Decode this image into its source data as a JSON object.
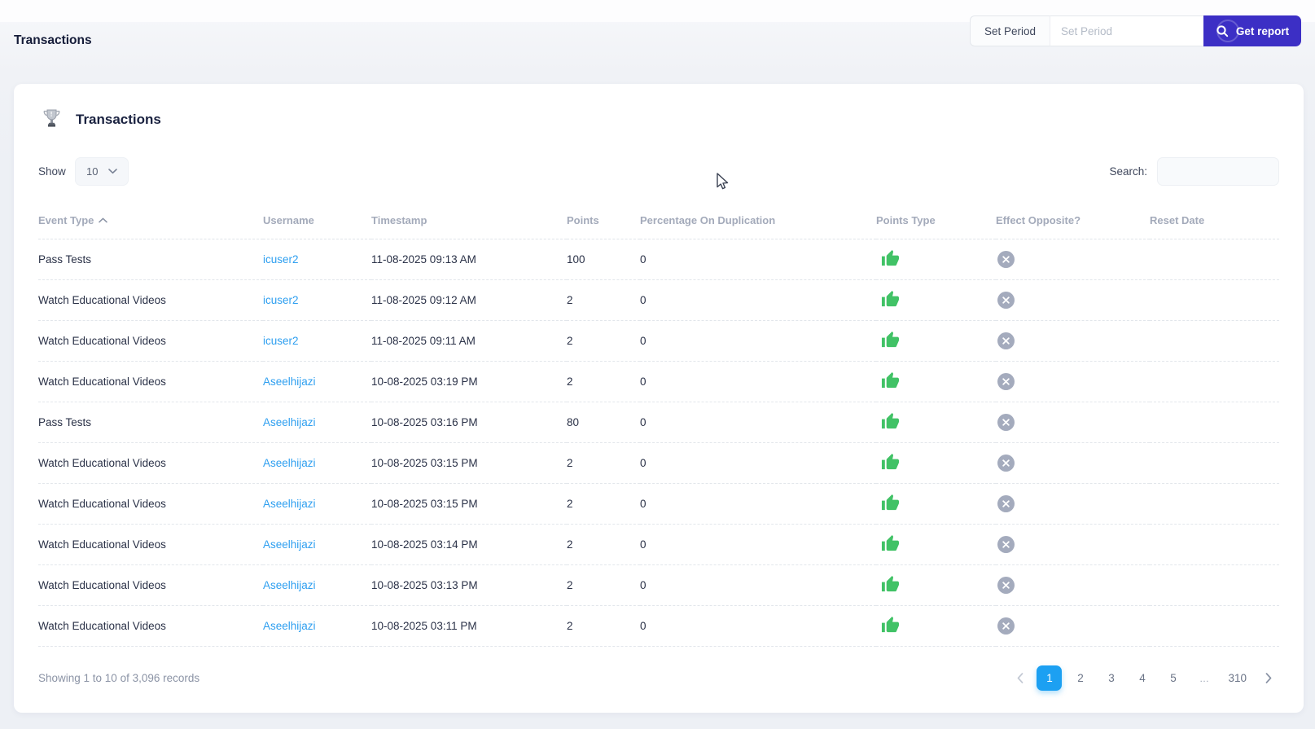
{
  "page": {
    "title": "Transactions"
  },
  "topbar": {
    "set_period_label": "Set Period",
    "set_period_placeholder": "Set Period",
    "set_period_value": "",
    "get_report_label": "Get report"
  },
  "card": {
    "title": "Transactions",
    "show_label": "Show",
    "show_value": "10",
    "search_label": "Search:",
    "search_value": ""
  },
  "table": {
    "columns": [
      {
        "label": "Event Type",
        "sort": "asc"
      },
      {
        "label": "Username"
      },
      {
        "label": "Timestamp"
      },
      {
        "label": "Points"
      },
      {
        "label": "Percentage On Duplication"
      },
      {
        "label": "Points Type"
      },
      {
        "label": "Effect Opposite?"
      },
      {
        "label": "Reset Date"
      }
    ],
    "rows": [
      {
        "event_type": "Pass Tests",
        "username": "icuser2",
        "timestamp": "11-08-2025 09:13 AM",
        "points": "100",
        "percentage": "0",
        "points_type": "thumbs-up",
        "effect_opposite": "x-circle",
        "reset_date": ""
      },
      {
        "event_type": "Watch Educational Videos",
        "username": "icuser2",
        "timestamp": "11-08-2025 09:12 AM",
        "points": "2",
        "percentage": "0",
        "points_type": "thumbs-up",
        "effect_opposite": "x-circle",
        "reset_date": ""
      },
      {
        "event_type": "Watch Educational Videos",
        "username": "icuser2",
        "timestamp": "11-08-2025 09:11 AM",
        "points": "2",
        "percentage": "0",
        "points_type": "thumbs-up",
        "effect_opposite": "x-circle",
        "reset_date": ""
      },
      {
        "event_type": "Watch Educational Videos",
        "username": "Aseelhijazi",
        "timestamp": "10-08-2025 03:19 PM",
        "points": "2",
        "percentage": "0",
        "points_type": "thumbs-up",
        "effect_opposite": "x-circle",
        "reset_date": ""
      },
      {
        "event_type": "Pass Tests",
        "username": "Aseelhijazi",
        "timestamp": "10-08-2025 03:16 PM",
        "points": "80",
        "percentage": "0",
        "points_type": "thumbs-up",
        "effect_opposite": "x-circle",
        "reset_date": ""
      },
      {
        "event_type": "Watch Educational Videos",
        "username": "Aseelhijazi",
        "timestamp": "10-08-2025 03:15 PM",
        "points": "2",
        "percentage": "0",
        "points_type": "thumbs-up",
        "effect_opposite": "x-circle",
        "reset_date": ""
      },
      {
        "event_type": "Watch Educational Videos",
        "username": "Aseelhijazi",
        "timestamp": "10-08-2025 03:15 PM",
        "points": "2",
        "percentage": "0",
        "points_type": "thumbs-up",
        "effect_opposite": "x-circle",
        "reset_date": ""
      },
      {
        "event_type": "Watch Educational Videos",
        "username": "Aseelhijazi",
        "timestamp": "10-08-2025 03:14 PM",
        "points": "2",
        "percentage": "0",
        "points_type": "thumbs-up",
        "effect_opposite": "x-circle",
        "reset_date": ""
      },
      {
        "event_type": "Watch Educational Videos",
        "username": "Aseelhijazi",
        "timestamp": "10-08-2025 03:13 PM",
        "points": "2",
        "percentage": "0",
        "points_type": "thumbs-up",
        "effect_opposite": "x-circle",
        "reset_date": ""
      },
      {
        "event_type": "Watch Educational Videos",
        "username": "Aseelhijazi",
        "timestamp": "10-08-2025 03:11 PM",
        "points": "2",
        "percentage": "0",
        "points_type": "thumbs-up",
        "effect_opposite": "x-circle",
        "reset_date": ""
      }
    ]
  },
  "footer": {
    "records_summary": "Showing 1 to 10 of 3,096 records",
    "pagination": {
      "prev_icon": "chevron-left-icon",
      "next_icon": "chevron-right-icon",
      "pages": [
        "1",
        "2",
        "3",
        "4",
        "5",
        "…",
        "310"
      ],
      "active_page": "1"
    }
  },
  "colors": {
    "accent_indigo": "#3c2fc5",
    "pagination_active_blue": "#1ca0f2",
    "link_blue": "#2e9ff0",
    "success_green": "#41c266",
    "badge_gray": "#a4abbd"
  }
}
